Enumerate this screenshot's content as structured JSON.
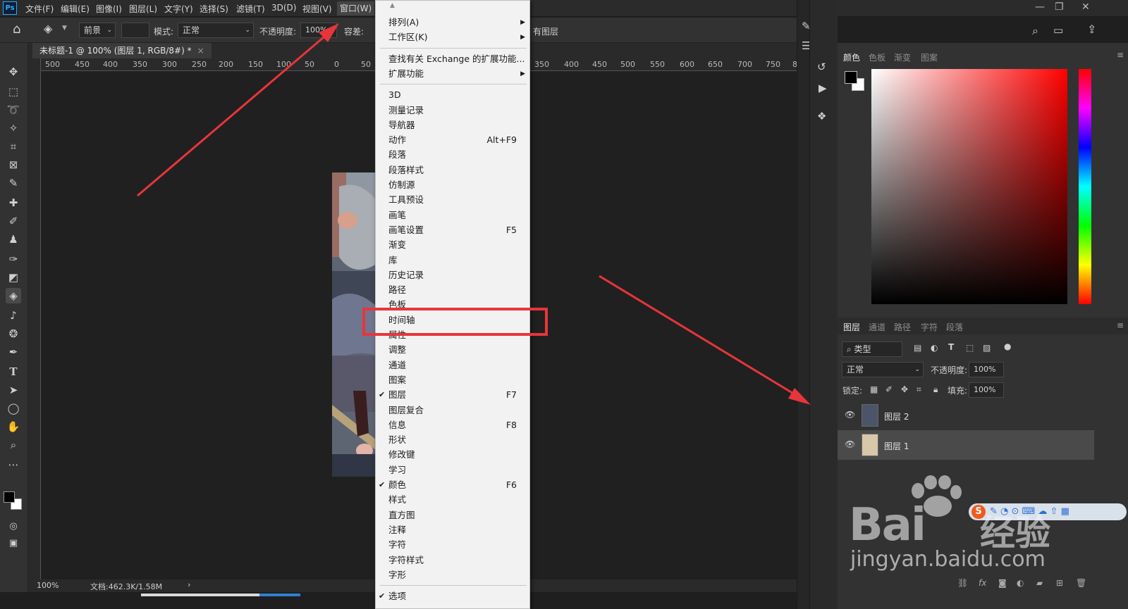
{
  "app": {
    "logo": "Ps"
  },
  "menubar": {
    "items": [
      "文件(F)",
      "编辑(E)",
      "图像(I)",
      "图层(L)",
      "文字(Y)",
      "选择(S)",
      "滤镜(T)",
      "3D(D)",
      "视图(V)",
      "窗口(W)"
    ]
  },
  "options": {
    "fg_label": "前景",
    "mode_label": "模式:",
    "mode_value": "正常",
    "opacity_label": "不透明度:",
    "opacity_value": "100%",
    "tolerance_label": "容差:",
    "extra_label": "有图层"
  },
  "document": {
    "tab_title": "未标题-1 @ 100% (图层 1, RGB/8#) *",
    "zoom": "100%",
    "doc_info": "文档:462.3K/1.58M",
    "ruler_ticks": [
      "500",
      "450",
      "400",
      "350",
      "300",
      "250",
      "200",
      "150",
      "100",
      "50",
      "0",
      "50",
      "350",
      "400",
      "450",
      "500",
      "550",
      "600",
      "650",
      "700",
      "750",
      "8"
    ]
  },
  "window_menu": {
    "groups": [
      [
        {
          "label": "排列(A)",
          "submenu": true
        },
        {
          "label": "工作区(K)",
          "submenu": true
        }
      ],
      [
        {
          "label": "查找有关 Exchange 的扩展功能..."
        },
        {
          "label": "扩展功能",
          "submenu": true
        }
      ],
      [
        {
          "label": "3D"
        },
        {
          "label": "测量记录"
        },
        {
          "label": "导航器"
        },
        {
          "label": "动作",
          "shortcut": "Alt+F9"
        },
        {
          "label": "段落"
        },
        {
          "label": "段落样式"
        },
        {
          "label": "仿制源"
        },
        {
          "label": "工具预设"
        },
        {
          "label": "画笔"
        },
        {
          "label": "画笔设置",
          "shortcut": "F5"
        },
        {
          "label": "渐变"
        },
        {
          "label": "库"
        },
        {
          "label": "历史记录"
        },
        {
          "label": "路径"
        },
        {
          "label": "色板"
        },
        {
          "label": "时间轴"
        },
        {
          "label": "属性"
        },
        {
          "label": "调整"
        },
        {
          "label": "通道"
        },
        {
          "label": "图案"
        },
        {
          "label": "图层",
          "shortcut": "F7",
          "checked": true
        },
        {
          "label": "图层复合"
        },
        {
          "label": "信息",
          "shortcut": "F8"
        },
        {
          "label": "形状"
        },
        {
          "label": "修改键"
        },
        {
          "label": "学习"
        },
        {
          "label": "颜色",
          "shortcut": "F6",
          "checked": true
        },
        {
          "label": "样式"
        },
        {
          "label": "直方图"
        },
        {
          "label": "注释"
        },
        {
          "label": "字符"
        },
        {
          "label": "字符样式"
        },
        {
          "label": "字形"
        }
      ],
      [
        {
          "label": "选项",
          "checked": true
        }
      ]
    ]
  },
  "color_panel": {
    "tabs": [
      "颜色",
      "色板",
      "渐变",
      "图案"
    ]
  },
  "layers_panel": {
    "tabs": [
      "图层",
      "通道",
      "路径",
      "字符",
      "段落"
    ],
    "filter_label": "类型",
    "blend_mode": "正常",
    "opacity_label": "不透明度:",
    "opacity_value": "100%",
    "lock_label": "锁定:",
    "fill_label": "填充:",
    "fill_value": "100%",
    "layers": [
      {
        "name": "图层 2",
        "selected": false
      },
      {
        "name": "图层 1",
        "selected": true
      }
    ]
  },
  "watermark": {
    "brand": "Bai",
    "brand_cn": "经验",
    "url": "jingyan.baidu.com"
  },
  "colors": {
    "highlight": "#e8353a",
    "menu_bg": "#f2f2f2",
    "app_bg": "#1f1f1f",
    "panel_bg": "#323232"
  }
}
